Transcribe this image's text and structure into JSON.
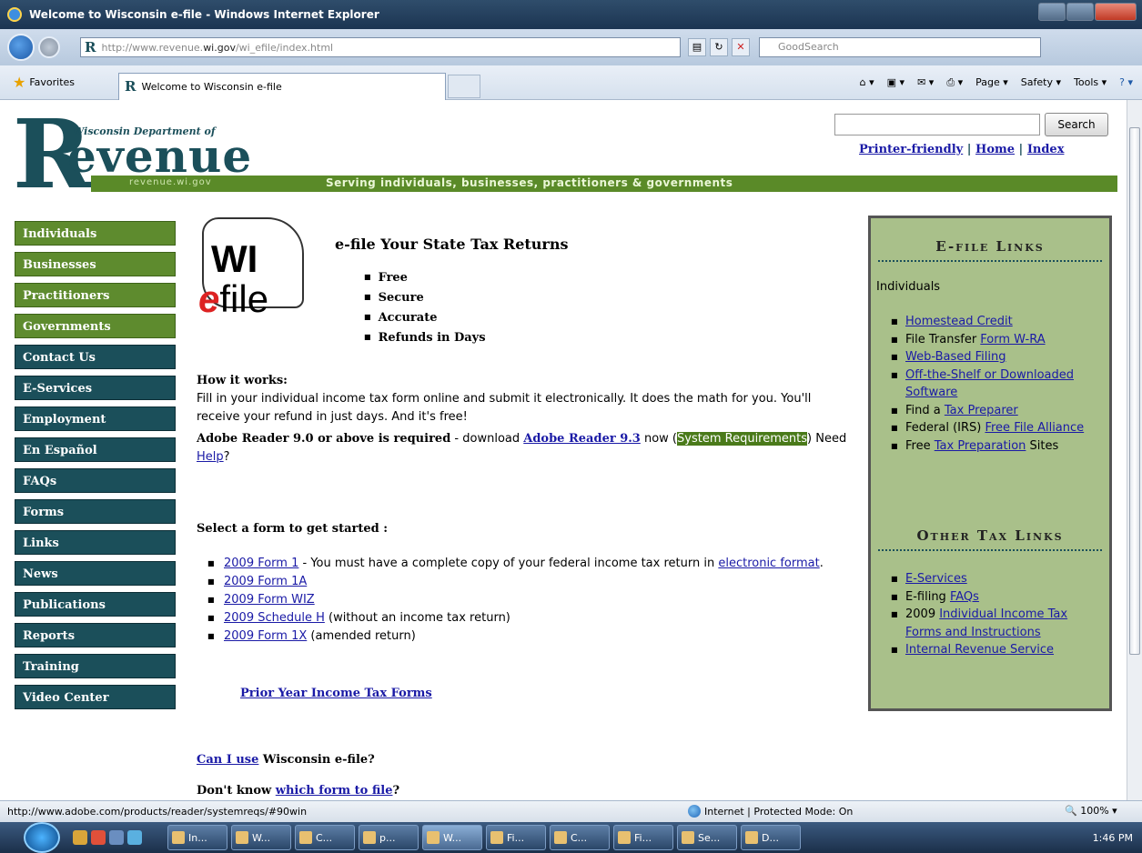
{
  "window": {
    "title": "Welcome to Wisconsin e-file - Windows Internet Explorer"
  },
  "address": {
    "url_prefix": "http://www.revenue.",
    "url_domain": "wi.gov",
    "url_path": "/wi_efile/index.html",
    "search_placeholder": "GoodSearch"
  },
  "favorites": {
    "label": "Favorites",
    "tab_title": "Welcome to Wisconsin e-file"
  },
  "commands": {
    "page": "Page ▾",
    "safety": "Safety ▾",
    "tools": "Tools ▾"
  },
  "header": {
    "dept": "Wisconsin Department of",
    "logo_rest": "evenue",
    "domain": "revenue.wi.gov",
    "tagline": "Serving individuals, businesses, practitioners & governments",
    "search_button": "Search",
    "links": {
      "printer": "Printer-friendly",
      "home": "Home",
      "index": "Index",
      "sep": "|"
    }
  },
  "nav": [
    {
      "label": "Individuals",
      "style": "g"
    },
    {
      "label": "Businesses",
      "style": "g"
    },
    {
      "label": "Practitioners",
      "style": "g"
    },
    {
      "label": "Governments",
      "style": "g"
    },
    {
      "label": "Contact Us",
      "style": "b"
    },
    {
      "label": "E-Services",
      "style": "b"
    },
    {
      "label": "Employment",
      "style": "b"
    },
    {
      "label": "En Español",
      "style": "b"
    },
    {
      "label": "FAQs",
      "style": "b"
    },
    {
      "label": "Forms",
      "style": "b"
    },
    {
      "label": "Links",
      "style": "b"
    },
    {
      "label": "News",
      "style": "b"
    },
    {
      "label": "Publications",
      "style": "b"
    },
    {
      "label": "Reports",
      "style": "b"
    },
    {
      "label": "Training",
      "style": "b"
    },
    {
      "label": "Video Center",
      "style": "b"
    }
  ],
  "main": {
    "logo_wi": "WI",
    "logo_e": "e",
    "logo_file": "file",
    "title": "e-file Your State Tax Returns",
    "benefits": [
      "Free",
      "Secure",
      "Accurate",
      "Refunds in Days"
    ],
    "how_heading": "How it works:",
    "how_text": "Fill in your individual income tax form online and submit it electronically. It does the math for you. You'll receive your refund in just days. And it's free!",
    "adobe_req": "Adobe Reader 9.0 or above is required",
    "adobe_dash": " - download ",
    "adobe_link": "Adobe Reader 9.3",
    "adobe_now": " now (",
    "sysreq": "System Requirements",
    "need": ") Need ",
    "help": "Help",
    "qmark": "?",
    "select_heading": "Select a form to get started :",
    "forms": [
      {
        "link": "2009 Form 1",
        "text": " - You must have a complete copy of your federal income tax return in ",
        "link2": "electronic format",
        "after": "."
      },
      {
        "link": "2009 Form 1A",
        "text": ""
      },
      {
        "link": "2009 Form WIZ",
        "text": ""
      },
      {
        "link": "2009 Schedule H",
        "text": " (without an income tax return)"
      },
      {
        "link": "2009 Form 1X",
        "text": " (amended return)"
      }
    ],
    "prior": "Prior Year Income Tax Forms",
    "canuse_link": "Can I use",
    "canuse_text": " Wisconsin e-file?",
    "dontknow_text": "Don't know ",
    "dontknow_link": "which form to file",
    "dontknow_q": "?"
  },
  "sidebar": {
    "efile_heading": "E-file Links",
    "individuals": "Individuals",
    "efile_links": [
      {
        "pre": "",
        "link": "Homestead Credit",
        "post": ""
      },
      {
        "pre": "File Transfer ",
        "link": "Form W-RA",
        "post": ""
      },
      {
        "pre": "",
        "link": "Web-Based Filing",
        "post": ""
      },
      {
        "pre": "",
        "link": "Off-the-Shelf or Downloaded Software",
        "post": ""
      },
      {
        "pre": "Find a ",
        "link": "Tax Preparer",
        "post": ""
      },
      {
        "pre": "Federal (IRS) ",
        "link": "Free File Alliance",
        "post": ""
      },
      {
        "pre": "Free ",
        "link": "Tax Preparation",
        "post": " Sites"
      }
    ],
    "other_heading": "Other Tax Links",
    "other_links": [
      {
        "pre": "",
        "link": "E-Services",
        "post": ""
      },
      {
        "pre": "E-filing ",
        "link": "FAQs",
        "post": ""
      },
      {
        "pre": "2009 ",
        "link": "Individual Income Tax Forms and Instructions",
        "post": ""
      },
      {
        "pre": "",
        "link": "Internal Revenue Service",
        "post": ""
      }
    ]
  },
  "status": {
    "url": "http://www.adobe.com/products/reader/systemreqs/#90win",
    "zone": "Internet | Protected Mode: On",
    "zoom": "100%"
  },
  "taskbar": {
    "tasks": [
      "In...",
      "W...",
      "C...",
      "p...",
      "W...",
      "Fi...",
      "C...",
      "Fi...",
      "Se...",
      "D..."
    ],
    "active_index": 4,
    "clock": "1:46 PM"
  }
}
